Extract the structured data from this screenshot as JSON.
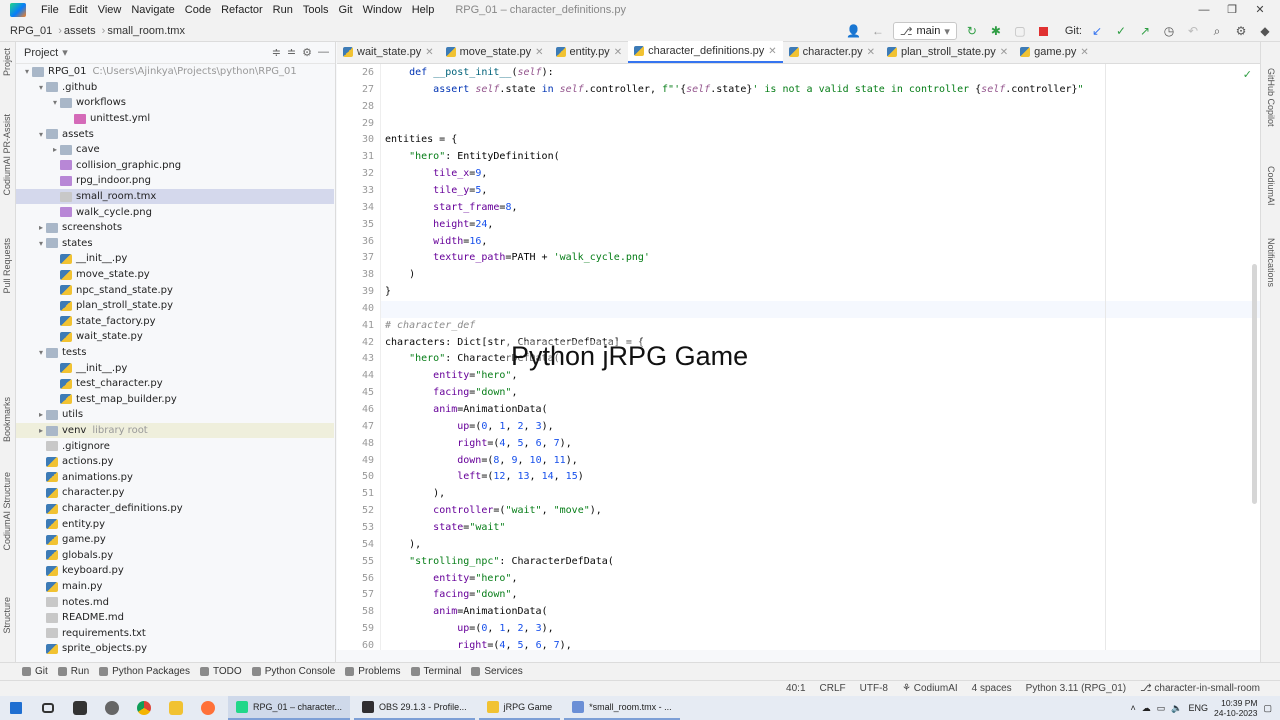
{
  "menu": [
    "File",
    "Edit",
    "View",
    "Navigate",
    "Code",
    "Refactor",
    "Run",
    "Tools",
    "Git",
    "Window",
    "Help"
  ],
  "window_title": "RPG_01 – character_definitions.py",
  "window_controls": [
    "—",
    "❐",
    "✕"
  ],
  "breadcrumb": {
    "project": "RPG_01",
    "folder": "assets",
    "file": "small_room.tmx"
  },
  "vcs": {
    "branch": "main",
    "git_label": "Git:"
  },
  "project_panel": {
    "title": "Project"
  },
  "tree": [
    {
      "label": "RPG_01",
      "hint": "C:\\Users\\Ajinkya\\Projects\\python\\RPG_01",
      "depth": 0,
      "arrow": "▾",
      "icon": "folder"
    },
    {
      "label": ".github",
      "depth": 1,
      "arrow": "▾",
      "icon": "folder"
    },
    {
      "label": "workflows",
      "depth": 2,
      "arrow": "▾",
      "icon": "folder"
    },
    {
      "label": "unittest.yml",
      "depth": 3,
      "arrow": "",
      "icon": "yml"
    },
    {
      "label": "assets",
      "depth": 1,
      "arrow": "▾",
      "icon": "folder"
    },
    {
      "label": "cave",
      "depth": 2,
      "arrow": "▸",
      "icon": "folder"
    },
    {
      "label": "collision_graphic.png",
      "depth": 2,
      "arrow": "",
      "icon": "img"
    },
    {
      "label": "rpg_indoor.png",
      "depth": 2,
      "arrow": "",
      "icon": "img"
    },
    {
      "label": "small_room.tmx",
      "depth": 2,
      "arrow": "",
      "icon": "doc",
      "selected": true
    },
    {
      "label": "walk_cycle.png",
      "depth": 2,
      "arrow": "",
      "icon": "img"
    },
    {
      "label": "screenshots",
      "depth": 1,
      "arrow": "▸",
      "icon": "folder"
    },
    {
      "label": "states",
      "depth": 1,
      "arrow": "▾",
      "icon": "folder"
    },
    {
      "label": "__init__.py",
      "depth": 2,
      "arrow": "",
      "icon": "pyf"
    },
    {
      "label": "move_state.py",
      "depth": 2,
      "arrow": "",
      "icon": "pyf"
    },
    {
      "label": "npc_stand_state.py",
      "depth": 2,
      "arrow": "",
      "icon": "pyf"
    },
    {
      "label": "plan_stroll_state.py",
      "depth": 2,
      "arrow": "",
      "icon": "pyf"
    },
    {
      "label": "state_factory.py",
      "depth": 2,
      "arrow": "",
      "icon": "pyf"
    },
    {
      "label": "wait_state.py",
      "depth": 2,
      "arrow": "",
      "icon": "pyf"
    },
    {
      "label": "tests",
      "depth": 1,
      "arrow": "▾",
      "icon": "folder"
    },
    {
      "label": "__init__.py",
      "depth": 2,
      "arrow": "",
      "icon": "pyf"
    },
    {
      "label": "test_character.py",
      "depth": 2,
      "arrow": "",
      "icon": "pyf"
    },
    {
      "label": "test_map_builder.py",
      "depth": 2,
      "arrow": "",
      "icon": "pyf"
    },
    {
      "label": "utils",
      "depth": 1,
      "arrow": "▸",
      "icon": "folder"
    },
    {
      "label": "venv",
      "hint": "library root",
      "depth": 1,
      "arrow": "▸",
      "icon": "folder",
      "venv": true
    },
    {
      "label": ".gitignore",
      "depth": 1,
      "arrow": "",
      "icon": "doc"
    },
    {
      "label": "actions.py",
      "depth": 1,
      "arrow": "",
      "icon": "pyf"
    },
    {
      "label": "animations.py",
      "depth": 1,
      "arrow": "",
      "icon": "pyf"
    },
    {
      "label": "character.py",
      "depth": 1,
      "arrow": "",
      "icon": "pyf"
    },
    {
      "label": "character_definitions.py",
      "depth": 1,
      "arrow": "",
      "icon": "pyf"
    },
    {
      "label": "entity.py",
      "depth": 1,
      "arrow": "",
      "icon": "pyf"
    },
    {
      "label": "game.py",
      "depth": 1,
      "arrow": "",
      "icon": "pyf"
    },
    {
      "label": "globals.py",
      "depth": 1,
      "arrow": "",
      "icon": "pyf"
    },
    {
      "label": "keyboard.py",
      "depth": 1,
      "arrow": "",
      "icon": "pyf"
    },
    {
      "label": "main.py",
      "depth": 1,
      "arrow": "",
      "icon": "pyf"
    },
    {
      "label": "notes.md",
      "depth": 1,
      "arrow": "",
      "icon": "doc"
    },
    {
      "label": "README.md",
      "depth": 1,
      "arrow": "",
      "icon": "doc"
    },
    {
      "label": "requirements.txt",
      "depth": 1,
      "arrow": "",
      "icon": "doc"
    },
    {
      "label": "sprite_objects.py",
      "depth": 1,
      "arrow": "",
      "icon": "pyf"
    }
  ],
  "left_strip": [
    "Project",
    "CodiumAI PR-Assist",
    "Pull Requests",
    "Bookmarks",
    "CodiumAI Structure",
    "Structure"
  ],
  "right_strip": [
    "GitHub Copilot",
    "CodiumAI",
    "Notifications"
  ],
  "tabs": [
    {
      "label": "wait_state.py"
    },
    {
      "label": "move_state.py"
    },
    {
      "label": "entity.py"
    },
    {
      "label": "character_definitions.py",
      "active": true
    },
    {
      "label": "character.py"
    },
    {
      "label": "plan_stroll_state.py"
    },
    {
      "label": "game.py"
    }
  ],
  "code_lines": [
    {
      "n": "26",
      "html": "    <span class='kw'>def</span> <span class='fn'>__post_init__</span>(<span class='self'>self</span>):"
    },
    {
      "n": "27",
      "html": "        <span class='kw'>assert</span> <span class='self'>self</span>.state <span class='kw'>in</span> <span class='self'>self</span>.controller, <span class='str'>f\"'</span>{<span class='self'>self</span>.state}<span class='str'>' is not a valid state in controller </span>{<span class='self'>self</span>.controller}<span class='str'>\"</span>"
    },
    {
      "n": "28",
      "html": ""
    },
    {
      "n": "29",
      "html": ""
    },
    {
      "n": "30",
      "html": "entities = {"
    },
    {
      "n": "31",
      "html": "    <span class='str'>\"hero\"</span>: <span class='typ'>EntityDefinition</span>("
    },
    {
      "n": "32",
      "html": "        <span class='prm'>tile_x</span>=<span class='num'>9</span>,"
    },
    {
      "n": "33",
      "html": "        <span class='prm'>tile_y</span>=<span class='num'>5</span>,"
    },
    {
      "n": "34",
      "html": "        <span class='prm'>start_frame</span>=<span class='num'>8</span>,"
    },
    {
      "n": "35",
      "html": "        <span class='prm'>height</span>=<span class='num'>24</span>,"
    },
    {
      "n": "36",
      "html": "        <span class='prm'>width</span>=<span class='num'>16</span>,"
    },
    {
      "n": "37",
      "html": "        <span class='prm'>texture_path</span>=PATH + <span class='str'>'walk_cycle.png'</span>"
    },
    {
      "n": "38",
      "html": "    )"
    },
    {
      "n": "39",
      "html": "}"
    },
    {
      "n": "40",
      "html": ""
    },
    {
      "n": "41",
      "html": "<span class='cmt'># character_def</span>"
    },
    {
      "n": "42",
      "html": "characters: Dict[str, CharacterDefData] = {"
    },
    {
      "n": "43",
      "html": "    <span class='str'>\"hero\"</span>: CharacterDefData("
    },
    {
      "n": "44",
      "html": "        <span class='prm'>entity</span>=<span class='str'>\"hero\"</span>,"
    },
    {
      "n": "45",
      "html": "        <span class='prm'>facing</span>=<span class='str'>\"down\"</span>,"
    },
    {
      "n": "46",
      "html": "        <span class='prm'>anim</span>=AnimationData("
    },
    {
      "n": "47",
      "html": "            <span class='prm'>up</span>=(<span class='num'>0</span>, <span class='num'>1</span>, <span class='num'>2</span>, <span class='num'>3</span>),"
    },
    {
      "n": "48",
      "html": "            <span class='prm'>right</span>=(<span class='num'>4</span>, <span class='num'>5</span>, <span class='num'>6</span>, <span class='num'>7</span>),"
    },
    {
      "n": "49",
      "html": "            <span class='prm'>down</span>=(<span class='num'>8</span>, <span class='num'>9</span>, <span class='num'>10</span>, <span class='num'>11</span>),"
    },
    {
      "n": "50",
      "html": "            <span class='prm'>left</span>=(<span class='num'>12</span>, <span class='num'>13</span>, <span class='num'>14</span>, <span class='num'>15</span>)"
    },
    {
      "n": "51",
      "html": "        ),"
    },
    {
      "n": "52",
      "html": "        <span class='prm'>controller</span>=(<span class='str'>\"wait\"</span>, <span class='str'>\"move\"</span>),"
    },
    {
      "n": "53",
      "html": "        <span class='prm'>state</span>=<span class='str'>\"wait\"</span>"
    },
    {
      "n": "54",
      "html": "    ),"
    },
    {
      "n": "55",
      "html": "    <span class='str'>\"strolling_npc\"</span>: CharacterDefData("
    },
    {
      "n": "56",
      "html": "        <span class='prm'>entity</span>=<span class='str'>\"hero\"</span>,"
    },
    {
      "n": "57",
      "html": "        <span class='prm'>facing</span>=<span class='str'>\"down\"</span>,"
    },
    {
      "n": "58",
      "html": "        <span class='prm'>anim</span>=AnimationData("
    },
    {
      "n": "59",
      "html": "            <span class='prm'>up</span>=(<span class='num'>0</span>, <span class='num'>1</span>, <span class='num'>2</span>, <span class='num'>3</span>),"
    },
    {
      "n": "60",
      "html": "            <span class='prm'>right</span>=(<span class='num'>4</span>, <span class='num'>5</span>, <span class='num'>6</span>, <span class='num'>7</span>),"
    }
  ],
  "current_line": "40",
  "overlay_caption": "Python jRPG Game",
  "bottom_tools": [
    "Git",
    "Run",
    "Python Packages",
    "TODO",
    "Python Console",
    "Problems",
    "Terminal",
    "Services"
  ],
  "status": {
    "position": "40:1",
    "line_sep": "CRLF",
    "encoding": "UTF-8",
    "plugin": "CodiumAI",
    "indent": "4 spaces",
    "interpreter": "Python 3.11 (RPG_01)",
    "branch": "character-in-small-room"
  },
  "taskbar": {
    "apps": [
      {
        "label": "RPG_01 – character...",
        "color": "#21d789",
        "active": true
      },
      {
        "label": "OBS 29.1.3 - Profile...",
        "color": "#302e31"
      },
      {
        "label": "jRPG Game",
        "color": "#f1c232"
      },
      {
        "label": "*small_room.tmx - ...",
        "color": "#6b8fd6"
      }
    ],
    "lang": "ENG",
    "time": "10:39 PM",
    "date": "24-10-2023"
  },
  "colors": {
    "accent": "#3574f0",
    "selection": "#d4d8ec",
    "run_green": "#2f9e44",
    "stop_red": "#e03131"
  }
}
